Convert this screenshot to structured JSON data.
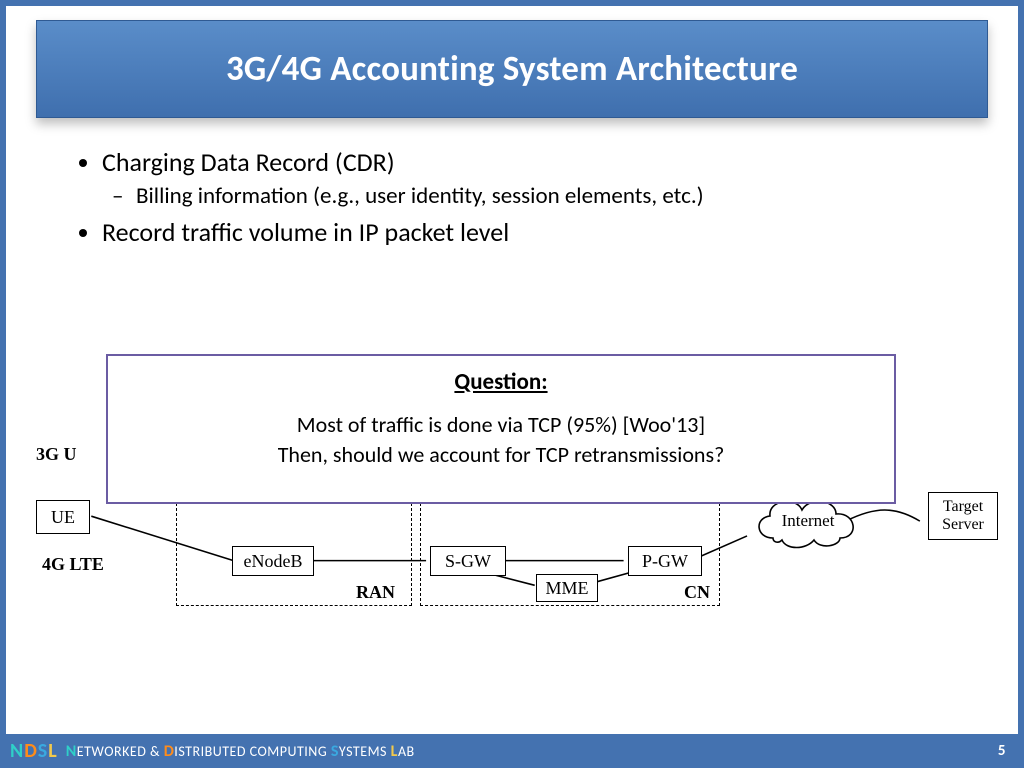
{
  "title": "3G/4G Accounting System Architecture",
  "bullets": {
    "b1": "Charging Data Record (CDR)",
    "b1_sub1": "Billing information (e.g., user identity, session elements, etc.)",
    "b2": "Record traffic volume in IP packet level"
  },
  "question": {
    "heading": "Question:",
    "line1": "Most of traffic is done via TCP (95%) [Woo'13]",
    "line2": "Then, should we account for TCP retransmissions?"
  },
  "diagram": {
    "side_labels": {
      "top": "3G U",
      "bottom": "4G LTE"
    },
    "zones": {
      "ran": "RAN",
      "cn": "CN"
    },
    "nodes": {
      "ue": "UE",
      "enodeb": "eNodeB",
      "sgw": "S-GW",
      "mme": "MME",
      "pgw": "P-GW",
      "internet": "Internet",
      "target": "Target Server"
    }
  },
  "footer": {
    "lab_parts": [
      "N",
      "ETWORKED & ",
      "D",
      "ISTRIBUTED COMPUTING ",
      "S",
      "YSTEMS ",
      "L",
      "AB"
    ],
    "page": "5"
  }
}
